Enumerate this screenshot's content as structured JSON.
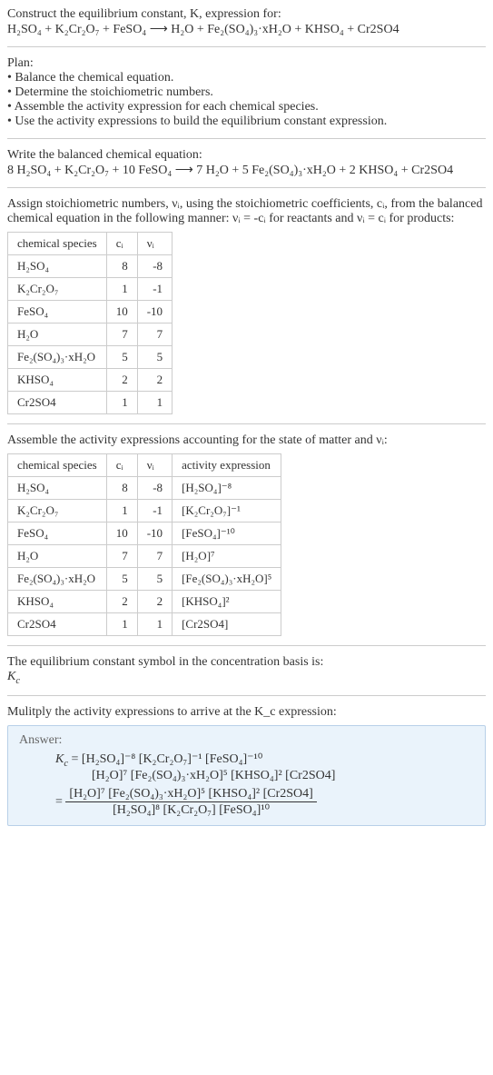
{
  "intro": {
    "line1": "Construct the equilibrium constant, K, expression for:",
    "equation": "H₂SO₄ + K₂Cr₂O₇ + FeSO₄  ⟶  H₂O + Fe₂(SO₄)₃·xH₂O + KHSO₄ + Cr2SO4"
  },
  "plan": {
    "heading": "Plan:",
    "items": [
      "Balance the chemical equation.",
      "Determine the stoichiometric numbers.",
      "Assemble the activity expression for each chemical species.",
      "Use the activity expressions to build the equilibrium constant expression."
    ]
  },
  "balanced": {
    "heading": "Write the balanced chemical equation:",
    "equation": "8 H₂SO₄ + K₂Cr₂O₇ + 10 FeSO₄  ⟶  7 H₂O + 5 Fe₂(SO₄)₃·xH₂O + 2 KHSO₄ + Cr2SO4"
  },
  "stoich": {
    "heading": "Assign stoichiometric numbers, νᵢ, using the stoichiometric coefficients, cᵢ, from the balanced chemical equation in the following manner: νᵢ = -cᵢ for reactants and νᵢ = cᵢ for products:",
    "headers": [
      "chemical species",
      "cᵢ",
      "νᵢ"
    ],
    "rows": [
      {
        "species": "H₂SO₄",
        "c": "8",
        "v": "-8"
      },
      {
        "species": "K₂Cr₂O₇",
        "c": "1",
        "v": "-1"
      },
      {
        "species": "FeSO₄",
        "c": "10",
        "v": "-10"
      },
      {
        "species": "H₂O",
        "c": "7",
        "v": "7"
      },
      {
        "species": "Fe₂(SO₄)₃·xH₂O",
        "c": "5",
        "v": "5"
      },
      {
        "species": "KHSO₄",
        "c": "2",
        "v": "2"
      },
      {
        "species": "Cr2SO4",
        "c": "1",
        "v": "1"
      }
    ]
  },
  "activity": {
    "heading": "Assemble the activity expressions accounting for the state of matter and νᵢ:",
    "headers": [
      "chemical species",
      "cᵢ",
      "νᵢ",
      "activity expression"
    ],
    "rows": [
      {
        "species": "H₂SO₄",
        "c": "8",
        "v": "-8",
        "expr": "[H₂SO₄]⁻⁸"
      },
      {
        "species": "K₂Cr₂O₇",
        "c": "1",
        "v": "-1",
        "expr": "[K₂Cr₂O₇]⁻¹"
      },
      {
        "species": "FeSO₄",
        "c": "10",
        "v": "-10",
        "expr": "[FeSO₄]⁻¹⁰"
      },
      {
        "species": "H₂O",
        "c": "7",
        "v": "7",
        "expr": "[H₂O]⁷"
      },
      {
        "species": "Fe₂(SO₄)₃·xH₂O",
        "c": "5",
        "v": "5",
        "expr": "[Fe₂(SO₄)₃·xH₂O]⁵"
      },
      {
        "species": "KHSO₄",
        "c": "2",
        "v": "2",
        "expr": "[KHSO₄]²"
      },
      {
        "species": "Cr2SO4",
        "c": "1",
        "v": "1",
        "expr": "[Cr2SO4]"
      }
    ]
  },
  "kc_symbol": {
    "heading": "The equilibrium constant symbol in the concentration basis is:",
    "symbol": "K_c"
  },
  "multiply": {
    "heading": "Mulitply the activity expressions to arrive at the K_c expression:"
  },
  "answer": {
    "label": "Answer:",
    "line1_left": "K_c = ",
    "line1_right": "[H₂SO₄]⁻⁸ [K₂Cr₂O₇]⁻¹ [FeSO₄]⁻¹⁰",
    "line2": "[H₂O]⁷ [Fe₂(SO₄)₃·xH₂O]⁵ [KHSO₄]² [Cr2SO4]",
    "frac_eq": "= ",
    "frac_num": "[H₂O]⁷ [Fe₂(SO₄)₃·xH₂O]⁵ [KHSO₄]² [Cr2SO4]",
    "frac_den": "[H₂SO₄]⁸ [K₂Cr₂O₇] [FeSO₄]¹⁰"
  }
}
